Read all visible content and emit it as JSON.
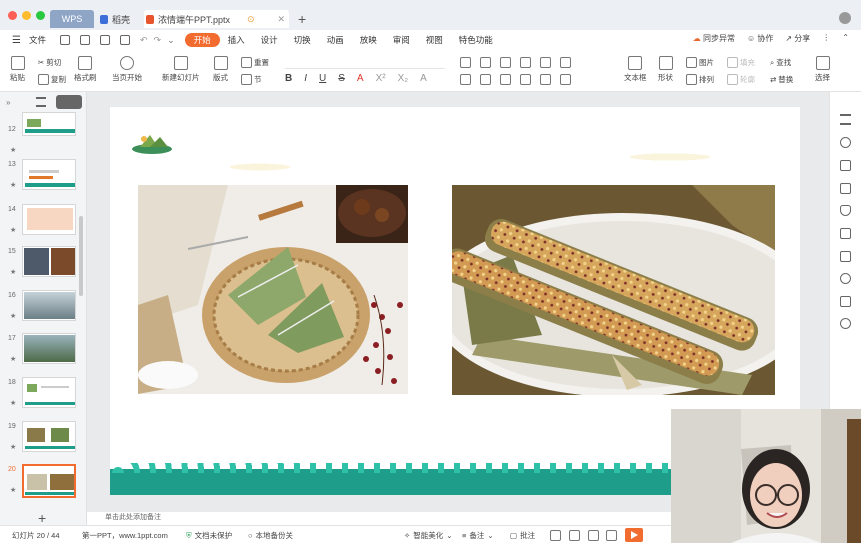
{
  "titlebar": {
    "tabs": [
      {
        "label": "WPS"
      },
      {
        "label": "稻壳"
      },
      {
        "label": "浓情端午PPT.pptx"
      }
    ]
  },
  "menu": {
    "file": "文件",
    "items": [
      "开始",
      "插入",
      "设计",
      "切换",
      "动画",
      "放映",
      "审阅",
      "视图",
      "特色功能"
    ],
    "right": [
      "同步异常",
      "协作",
      "分享"
    ]
  },
  "ribbon": {
    "paste": "粘贴",
    "cut": "剪切",
    "copy": "复制",
    "format_painter": "格式刷",
    "from_start": "当页开始",
    "new_slide": "新建幻灯片",
    "layout": "版式",
    "reset": "重置",
    "section": "节",
    "textbox": "文本框",
    "shape": "形状",
    "picture": "图片",
    "fill": "填充",
    "arrange": "排列",
    "outline": "轮廓",
    "find": "查找",
    "replace": "替换",
    "select": "选择"
  },
  "slides_panel": {
    "items": [
      {
        "num": "12"
      },
      {
        "num": "13"
      },
      {
        "num": "14"
      },
      {
        "num": "15"
      },
      {
        "num": "16"
      },
      {
        "num": "17"
      },
      {
        "num": "18"
      },
      {
        "num": "19"
      },
      {
        "num": "20"
      }
    ],
    "selected": "20"
  },
  "canvas": {
    "notes_placeholder": "单击此处添加备注"
  },
  "status": {
    "slide_count": "幻灯片 20 / 44",
    "theme": "第一PPT，www.1ppt.com",
    "doc_protect": "文档未保护",
    "local_backup": "本地备份关",
    "beautify": "智能美化",
    "notes": "备注",
    "comments": "批注"
  },
  "colors": {
    "accent": "#f26b2f",
    "teal": "#1e9e8a"
  }
}
